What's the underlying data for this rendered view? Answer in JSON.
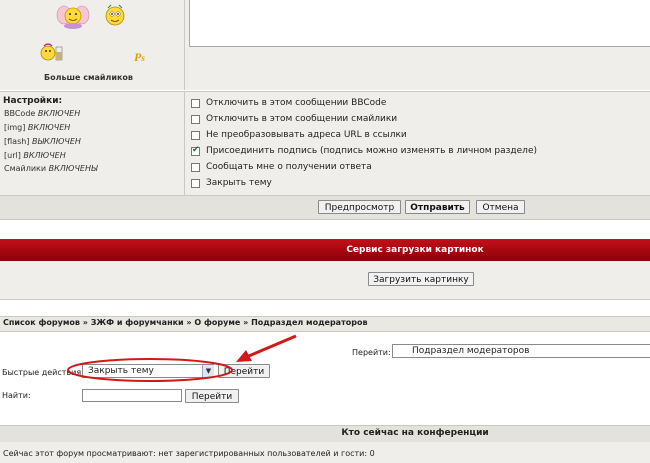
{
  "smilies": {
    "more_link": "Больше смайликов"
  },
  "settings": {
    "title": "Настройки:",
    "items": [
      {
        "name": "BBCode",
        "state": "ВКЛЮЧЕН"
      },
      {
        "name": "[img]",
        "state": "ВКЛЮЧЕН"
      },
      {
        "name": "[flash]",
        "state": "ВЫКЛЮЧЕН"
      },
      {
        "name": "[url]",
        "state": "ВКЛЮЧЕН"
      },
      {
        "name": "Смайлики",
        "state": "ВКЛЮЧЕНЫ"
      }
    ]
  },
  "options": [
    {
      "label": "Отключить в этом сообщении BBCode",
      "checked": false
    },
    {
      "label": "Отключить в этом сообщении смайлики",
      "checked": false
    },
    {
      "label": "Не преобразовывать адреса URL в ссылки",
      "checked": false
    },
    {
      "label": "Присоединить подпись (подпись можно изменять в личном разделе)",
      "checked": true
    },
    {
      "label": "Сообщать мне о получении ответа",
      "checked": false
    },
    {
      "label": "Закрыть тему",
      "checked": false
    }
  ],
  "buttons": {
    "preview": "Предпросмотр",
    "submit": "Отправить",
    "cancel": "Отмена"
  },
  "upload": {
    "title": "Сервис загрузки картинок",
    "button": "Загрузить картинку"
  },
  "breadcrumb": {
    "items": [
      "Список форумов",
      "ЗЖФ и форумчанки",
      "О форуме",
      "Подраздел модераторов"
    ],
    "separator": " » "
  },
  "jump": {
    "label": "Перейти:",
    "selected": "Подраздел модераторов"
  },
  "quick_actions": {
    "label": "Быстрые действия:",
    "selected": "Закрыть тему",
    "go": "Перейти"
  },
  "search": {
    "label": "Найти:",
    "value": "",
    "go": "Перейти"
  },
  "online": {
    "title": "Кто сейчас на конференции",
    "text": "Сейчас этот форум просматривают: нет зарегистрированных пользователей и гости: 0"
  },
  "colors": {
    "panel_bg": "#efeeea",
    "border": "#c9c8c2",
    "banner_red": "#a9000b",
    "annotation_red": "#d01a1a"
  }
}
